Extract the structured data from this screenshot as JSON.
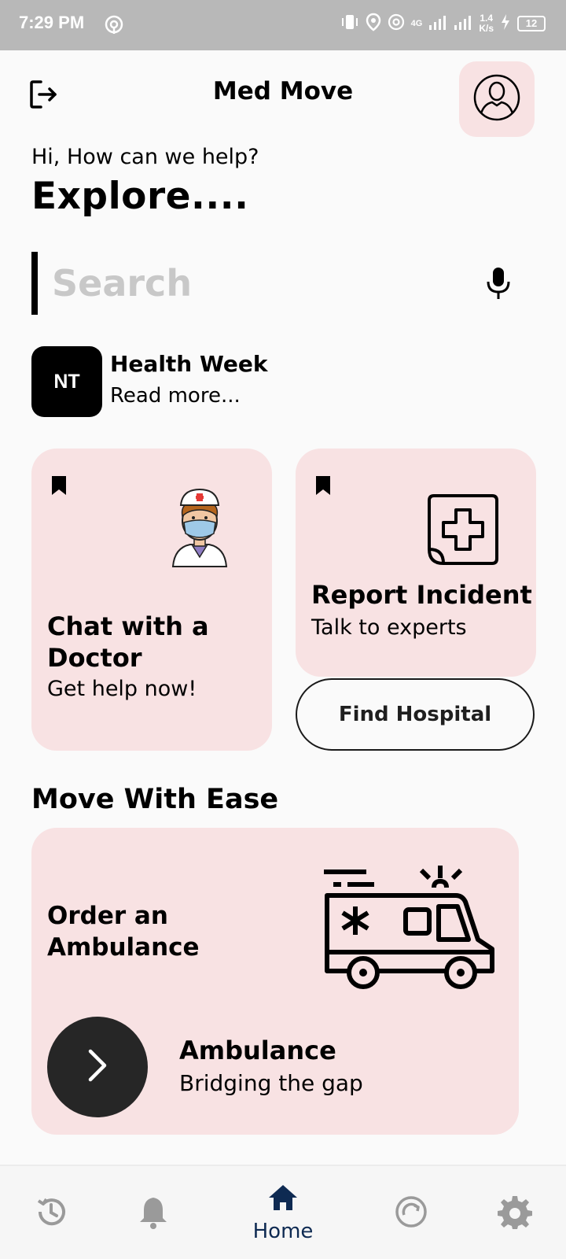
{
  "status_bar": {
    "time": "7:29 PM",
    "network_type": "4G",
    "speed_value": "1.4",
    "speed_unit": "K/s",
    "battery": "12"
  },
  "header": {
    "title": "Med Move",
    "logout_icon": "logout-icon",
    "profile_icon": "user-avatar-icon"
  },
  "hero": {
    "greeting": "Hi, How can we help?",
    "heading": "Explore...."
  },
  "search": {
    "placeholder": "Search",
    "mic_icon": "microphone-icon"
  },
  "news": {
    "avatar_text": "NT",
    "title": "Health Week",
    "link": "Read more..."
  },
  "cards": {
    "chat": {
      "title": "Chat with a Doctor",
      "subtitle": "Get help now!",
      "icon": "doctor-icon"
    },
    "report": {
      "title": "Report Incident",
      "subtitle": "Talk to experts",
      "icon": "medical-cross-icon"
    },
    "find_hospital_label": "Find Hospital"
  },
  "move_section": {
    "title": "Move With Ease",
    "order_title": "Order an Ambulance",
    "ambulance_title": "Ambulance",
    "ambulance_subtitle": "Bridging the gap"
  },
  "bottom_nav": {
    "items": [
      {
        "icon": "history-icon",
        "label": ""
      },
      {
        "icon": "bell-icon",
        "label": ""
      },
      {
        "icon": "home-icon",
        "label": "Home",
        "active": true
      },
      {
        "icon": "refresh-icon",
        "label": ""
      },
      {
        "icon": "gear-icon",
        "label": ""
      }
    ]
  },
  "colors": {
    "card_bg": "#f8e2e3",
    "active_nav": "#0e2a52",
    "inactive_nav": "#9a9a9a",
    "status_bar": "#b8b8b8"
  }
}
